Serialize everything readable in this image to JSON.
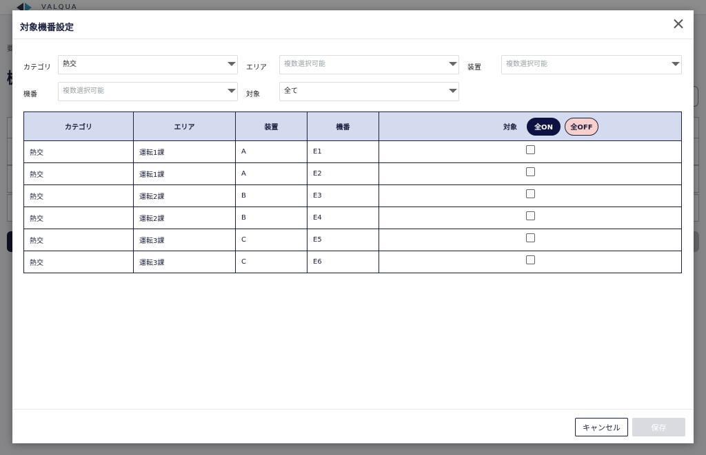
{
  "background": {
    "logo_text": "VALQUA"
  },
  "modal": {
    "title": "対象機番設定",
    "filters": {
      "category": {
        "label": "カテゴリ",
        "value": "熱交"
      },
      "area": {
        "label": "エリア",
        "placeholder": "複数選択可能"
      },
      "device": {
        "label": "装置",
        "placeholder": "複数選択可能"
      },
      "machine_no": {
        "label": "機番",
        "placeholder": "複数選択可能"
      },
      "target": {
        "label": "対象",
        "value": "全て"
      }
    },
    "table": {
      "headers": [
        "カテゴリ",
        "エリア",
        "装置",
        "機番",
        "対象"
      ],
      "all_on_label": "全ON",
      "all_off_label": "全OFF",
      "rows": [
        {
          "category": "熱交",
          "area": "運転1課",
          "device": "A",
          "machine_no": "E1",
          "checked": false
        },
        {
          "category": "熱交",
          "area": "運転1課",
          "device": "A",
          "machine_no": "E2",
          "checked": false
        },
        {
          "category": "熱交",
          "area": "運転2課",
          "device": "B",
          "machine_no": "E3",
          "checked": false
        },
        {
          "category": "熱交",
          "area": "運転2課",
          "device": "B",
          "machine_no": "E4",
          "checked": false
        },
        {
          "category": "熱交",
          "area": "運転3課",
          "device": "C",
          "machine_no": "E5",
          "checked": false
        },
        {
          "category": "熱交",
          "area": "運転3課",
          "device": "C",
          "machine_no": "E6",
          "checked": false
        }
      ]
    },
    "footer": {
      "cancel_label": "キャンセル",
      "save_label": "保存"
    }
  },
  "colors": {
    "primary": "#0d1240",
    "table_header_bg": "#d5dbef",
    "all_off_bg": "#f7cfcc",
    "save_disabled_bg": "#d9dbe0"
  }
}
